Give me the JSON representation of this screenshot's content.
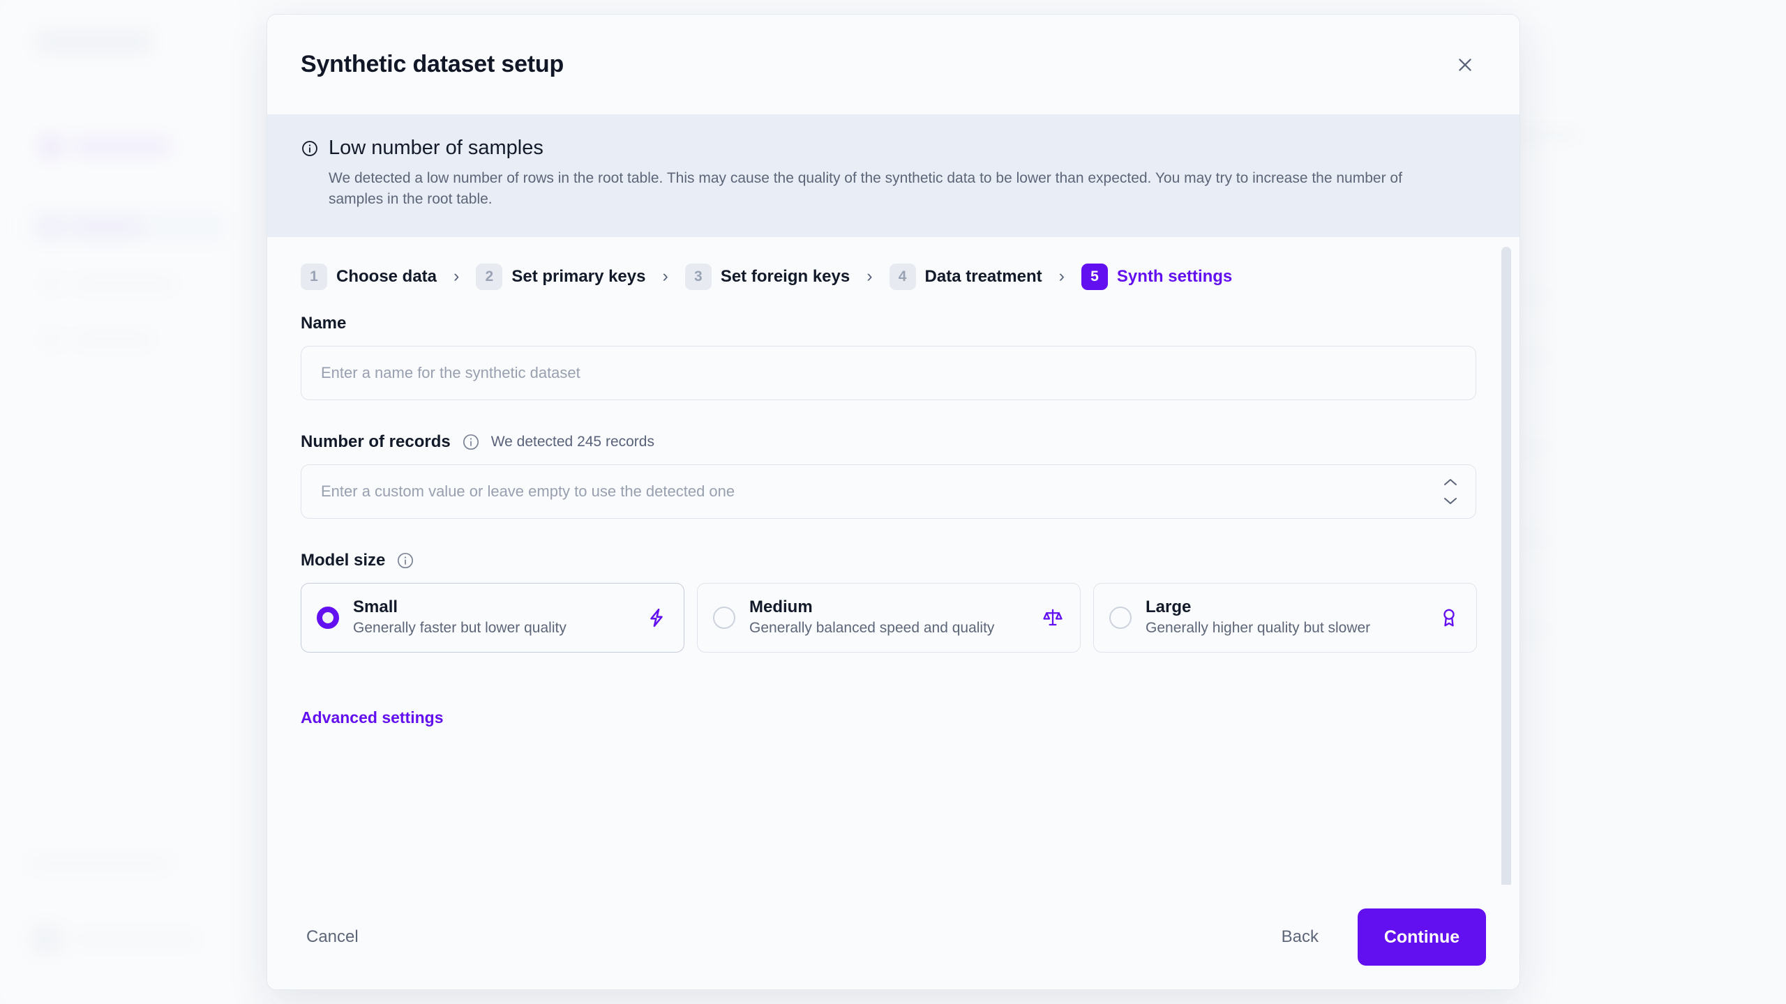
{
  "modal": {
    "title": "Synthetic dataset setup",
    "close_icon": "close-icon"
  },
  "alert": {
    "icon": "info-circle-icon",
    "title": "Low number of samples",
    "body": "We detected a low number of rows in the root table. This may cause the quality of the synthetic data to be lower than expected. You may try to increase the number of samples in the root table."
  },
  "stepper": {
    "separator": "›",
    "steps": [
      {
        "number": "1",
        "label": "Choose data",
        "active": false
      },
      {
        "number": "2",
        "label": "Set primary keys",
        "active": false
      },
      {
        "number": "3",
        "label": "Set foreign keys",
        "active": false
      },
      {
        "number": "4",
        "label": "Data treatment",
        "active": false
      },
      {
        "number": "5",
        "label": "Synth settings",
        "active": true
      }
    ]
  },
  "form": {
    "name": {
      "label": "Name",
      "value": "",
      "placeholder": "Enter a name for the synthetic dataset"
    },
    "records": {
      "label": "Number of records",
      "info_icon": "info-circle-icon",
      "hint": "We detected 245 records",
      "value": "",
      "placeholder": "Enter a custom value or leave empty to use the detected one",
      "increment_icon": "chevron-up-icon",
      "decrement_icon": "chevron-down-icon"
    },
    "model_size": {
      "label": "Model size",
      "info_icon": "info-circle-icon",
      "options": [
        {
          "title": "Small",
          "description": "Generally faster but lower quality",
          "icon": "lightning-bolt-icon",
          "selected": true
        },
        {
          "title": "Medium",
          "description": "Generally balanced speed and quality",
          "icon": "scales-balance-icon",
          "selected": false
        },
        {
          "title": "Large",
          "description": "Generally higher quality but slower",
          "icon": "award-ribbon-icon",
          "selected": false
        }
      ]
    },
    "advanced_settings_label": "Advanced settings"
  },
  "footer": {
    "cancel_label": "Cancel",
    "back_label": "Back",
    "continue_label": "Continue"
  },
  "colors": {
    "accent": "#6310F0",
    "alert_bg": "#E9EDF5",
    "modal_bg": "#FAFBFC",
    "text_primary": "#121929",
    "text_muted": "#5D6678"
  }
}
